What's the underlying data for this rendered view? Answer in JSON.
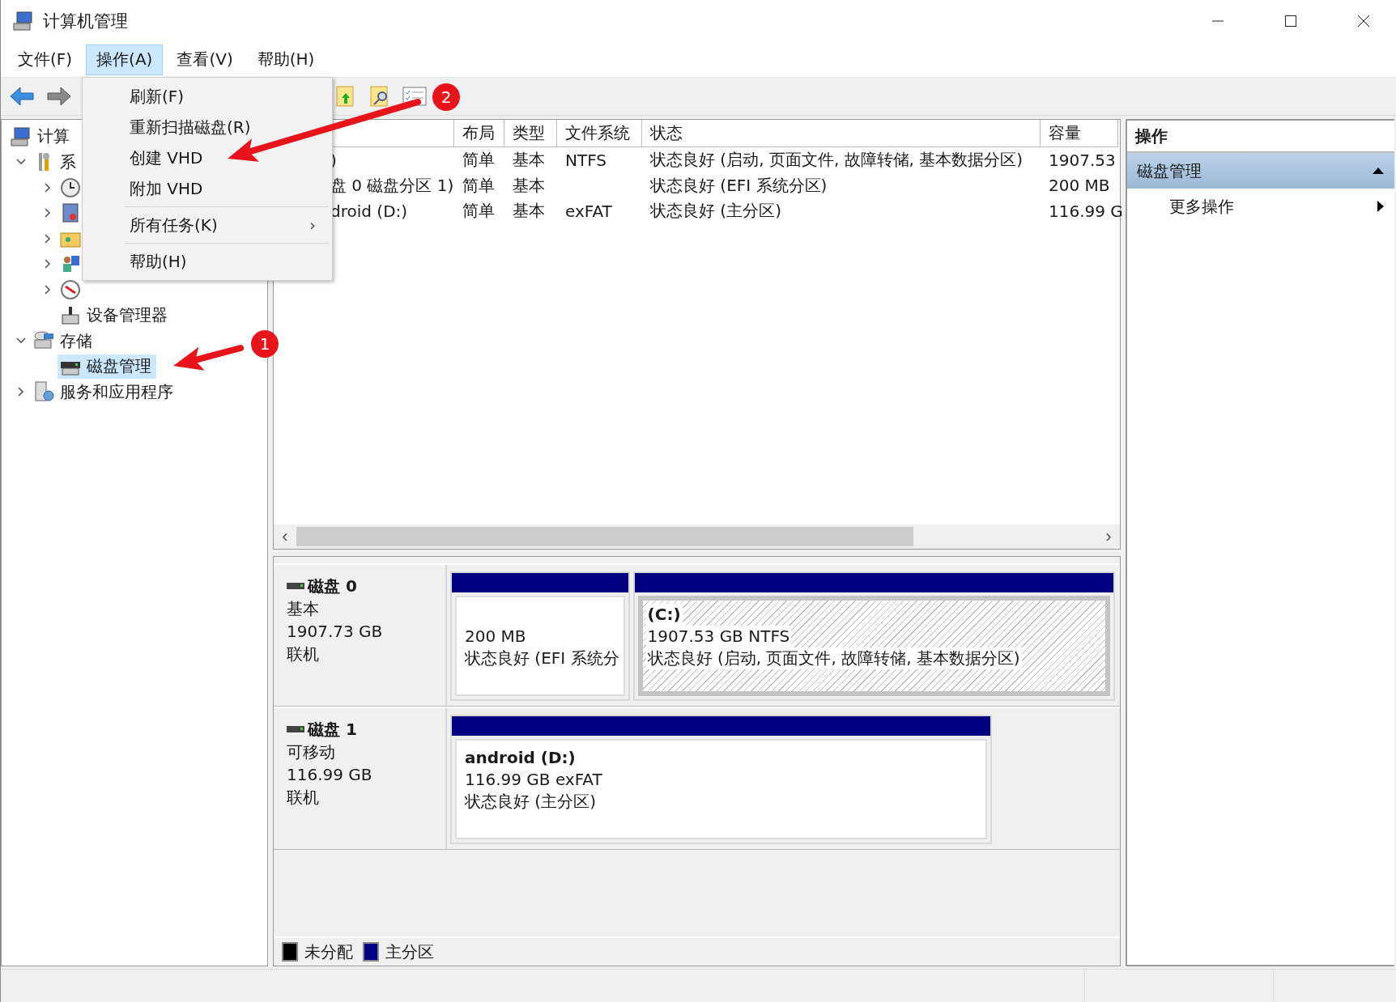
{
  "window": {
    "title": "计算机管理"
  },
  "menu_bar": [
    {
      "label": "文件(F)",
      "selected": false
    },
    {
      "label": "操作(A)",
      "selected": true
    },
    {
      "label": "查看(V)",
      "selected": false
    },
    {
      "label": "帮助(H)",
      "selected": false
    }
  ],
  "action_menu": [
    {
      "kind": "item",
      "label": "刷新(F)"
    },
    {
      "kind": "item",
      "label": "重新扫描磁盘(R)"
    },
    {
      "kind": "item",
      "label": "创建 VHD"
    },
    {
      "kind": "item",
      "label": "附加 VHD"
    },
    {
      "kind": "separator"
    },
    {
      "kind": "submenu",
      "label": "所有任务(K)",
      "arrow": "›"
    },
    {
      "kind": "separator"
    },
    {
      "kind": "item",
      "label": "帮助(H)"
    }
  ],
  "tree": [
    {
      "label": "计算",
      "selected": false,
      "children": [
        {
          "label": "系",
          "expanded": true,
          "selected": false,
          "children": [
            {
              "expanded": false,
              "selected": false
            },
            {
              "expanded": false,
              "selected": false
            },
            {
              "expanded": false,
              "selected": false
            },
            {
              "expanded": false,
              "selected": false
            },
            {
              "expanded": false,
              "selected": false
            },
            {
              "label": "设备管理器",
              "selected": false
            }
          ]
        },
        {
          "label": "存储",
          "expanded": true,
          "selected": false,
          "children": [
            {
              "label": "磁盘管理",
              "selected": true
            }
          ]
        },
        {
          "label": "服务和应用程序",
          "expanded": false,
          "selected": false
        }
      ]
    }
  ],
  "volume_table": {
    "columns": [
      "",
      "布局",
      "类型",
      "文件系统",
      "状态",
      "容量"
    ],
    "rows": [
      {
        "cells": [
          ")",
          "简单",
          "基本",
          "NTFS",
          "状态良好 (启动, 页面文件, 故障转储, 基本数据分区)",
          "1907.53"
        ]
      },
      {
        "cells": [
          "盘 0 磁盘分区 1)",
          "简单",
          "基本",
          null,
          "状态良好 (EFI 系统分区)",
          "200 MB"
        ]
      },
      {
        "cells": [
          "droid (D:)",
          "简单",
          "基本",
          "exFAT",
          "状态良好 (主分区)",
          "116.99 G"
        ]
      }
    ],
    "scroll_left": "‹",
    "scroll_right": "›"
  },
  "disks": [
    {
      "name": "磁盘 0",
      "type": "基本",
      "size": "1907.73 GB",
      "status": "联机",
      "partitions": [
        {
          "size": "200 MB",
          "status": "状态良好 (EFI 系统分",
          "selected": false
        },
        {
          "label": "(C:)",
          "size": "1907.53 GB NTFS",
          "status": "状态良好 (启动, 页面文件, 故障转储, 基本数据分区)",
          "selected": true
        }
      ]
    },
    {
      "name": "磁盘 1",
      "type": "可移动",
      "size": "116.99 GB",
      "status": "联机",
      "partitions": [
        {
          "label": "android  (D:)",
          "size": "116.99 GB exFAT",
          "status": "状态良好 (主分区)",
          "selected": false
        }
      ]
    }
  ],
  "legend": [
    {
      "label": "未分配",
      "color": "#000000"
    },
    {
      "label": "主分区",
      "color": "#000080"
    }
  ],
  "actions_panel": {
    "title": "操作",
    "section": {
      "label": "磁盘管理",
      "expanded": true
    },
    "items": [
      "更多操作"
    ]
  },
  "annotations": [
    {
      "number": "1"
    },
    {
      "number": "2"
    }
  ]
}
